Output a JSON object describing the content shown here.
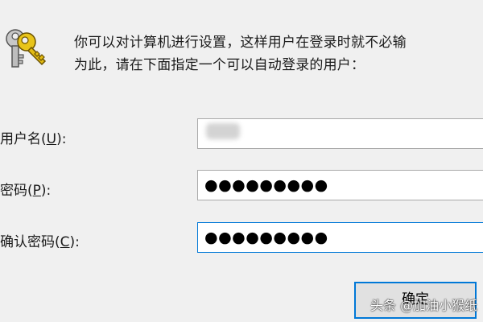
{
  "dialog": {
    "description_line1": "你可以对计算机进行设置，这样用户在登录时就不必输",
    "description_line2": "为此，请在下面指定一个可以自动登录的用户："
  },
  "fields": {
    "username": {
      "label_pre": "用户名(",
      "label_key": "U",
      "label_post": "):",
      "value_masked": ""
    },
    "password": {
      "label_pre": "密码(",
      "label_key": "P",
      "label_post": "):",
      "value_masked": "●●●●●●●●●"
    },
    "confirm_password": {
      "label_pre": "确认密码(",
      "label_key": "C",
      "label_post": "):",
      "value_masked": "●●●●●●●●●"
    }
  },
  "buttons": {
    "ok_label": "确定"
  },
  "watermark": {
    "text": "头条 @加油小猴纸"
  },
  "icons": {
    "header": "keys-icon"
  },
  "colors": {
    "background": "#f0f0f0",
    "focus_border": "#0078d7",
    "field_border": "#a9a9a9"
  }
}
